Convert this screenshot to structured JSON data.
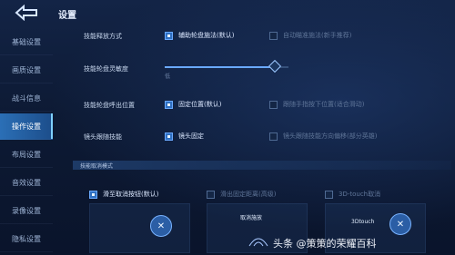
{
  "header": {
    "title": "设置"
  },
  "sidebar": {
    "items": [
      {
        "label": "基础设置"
      },
      {
        "label": "操作设置"
      },
      {
        "label": "画质设置"
      },
      {
        "label": "战斗信息"
      },
      {
        "label": "操作设置"
      },
      {
        "label": "布局设置"
      },
      {
        "label": "音效设置"
      },
      {
        "label": "录像设置"
      },
      {
        "label": "隐私设置"
      }
    ]
  },
  "settings": {
    "release_mode": {
      "label": "技能释放方式",
      "opt1": "辅助轮盘施法(默认)",
      "opt2": "自动瞄准施法(新手推荐)"
    },
    "sensitivity": {
      "label": "技能轮盘灵敏度",
      "min_label": "低",
      "value_fraction": 0.89
    },
    "wheel_position": {
      "label": "技能轮盘呼出位置",
      "opt1": "固定位置(默认)",
      "opt2": "跟随手指按下位置(适合滑动)"
    },
    "camera_follow": {
      "label": "镜头跟随技能",
      "opt1": "镜头固定",
      "opt2": "镜头跟随技能方向偏移(部分英雄)"
    },
    "cancel_mode": {
      "label": "技能取消模式",
      "opt1": "滑至取消按钮(默认)",
      "opt2": "滑出固定距离(高级)",
      "opt3": "3D-touch取消"
    }
  },
  "previews": {
    "p2_text": "取消施放",
    "p3_text": "3Dtouch"
  },
  "watermark": "头条 @策策的荣耀百科"
}
